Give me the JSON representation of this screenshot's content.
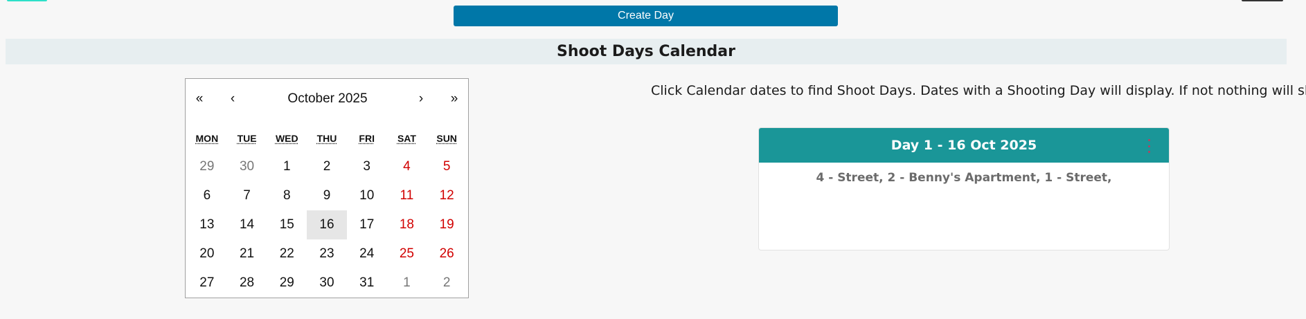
{
  "actions": {
    "create_day_label": "Create Day"
  },
  "section": {
    "title": "Shoot Days Calendar"
  },
  "calendar": {
    "nav": {
      "first": "«",
      "prev": "‹",
      "label": "October 2025",
      "next": "›",
      "last": "»"
    },
    "weekdays": [
      "MON",
      "TUE",
      "WED",
      "THU",
      "FRI",
      "SAT",
      "SUN"
    ],
    "days": [
      {
        "d": "29",
        "neighbor": true,
        "weekend": false
      },
      {
        "d": "30",
        "neighbor": true,
        "weekend": false
      },
      {
        "d": "1",
        "neighbor": false,
        "weekend": false
      },
      {
        "d": "2",
        "neighbor": false,
        "weekend": false
      },
      {
        "d": "3",
        "neighbor": false,
        "weekend": false
      },
      {
        "d": "4",
        "neighbor": false,
        "weekend": true
      },
      {
        "d": "5",
        "neighbor": false,
        "weekend": true
      },
      {
        "d": "6",
        "neighbor": false,
        "weekend": false
      },
      {
        "d": "7",
        "neighbor": false,
        "weekend": false
      },
      {
        "d": "8",
        "neighbor": false,
        "weekend": false
      },
      {
        "d": "9",
        "neighbor": false,
        "weekend": false
      },
      {
        "d": "10",
        "neighbor": false,
        "weekend": false
      },
      {
        "d": "11",
        "neighbor": false,
        "weekend": true
      },
      {
        "d": "12",
        "neighbor": false,
        "weekend": true
      },
      {
        "d": "13",
        "neighbor": false,
        "weekend": false
      },
      {
        "d": "14",
        "neighbor": false,
        "weekend": false
      },
      {
        "d": "15",
        "neighbor": false,
        "weekend": false
      },
      {
        "d": "16",
        "neighbor": false,
        "weekend": false,
        "selected": true
      },
      {
        "d": "17",
        "neighbor": false,
        "weekend": false
      },
      {
        "d": "18",
        "neighbor": false,
        "weekend": true
      },
      {
        "d": "19",
        "neighbor": false,
        "weekend": true
      },
      {
        "d": "20",
        "neighbor": false,
        "weekend": false
      },
      {
        "d": "21",
        "neighbor": false,
        "weekend": false
      },
      {
        "d": "22",
        "neighbor": false,
        "weekend": false
      },
      {
        "d": "23",
        "neighbor": false,
        "weekend": false
      },
      {
        "d": "24",
        "neighbor": false,
        "weekend": false
      },
      {
        "d": "25",
        "neighbor": false,
        "weekend": true
      },
      {
        "d": "26",
        "neighbor": false,
        "weekend": true
      },
      {
        "d": "27",
        "neighbor": false,
        "weekend": false
      },
      {
        "d": "28",
        "neighbor": false,
        "weekend": false
      },
      {
        "d": "29",
        "neighbor": false,
        "weekend": false
      },
      {
        "d": "30",
        "neighbor": false,
        "weekend": false
      },
      {
        "d": "31",
        "neighbor": false,
        "weekend": false
      },
      {
        "d": "1",
        "neighbor": true,
        "weekend": false
      },
      {
        "d": "2",
        "neighbor": true,
        "weekend": false
      }
    ]
  },
  "instructions": "Click Calendar dates to find Shoot Days. Dates with a Shooting Day will display. If not nothing will show.",
  "shoot_day_card": {
    "title": "Day 1 - 16 Oct 2025",
    "menu_icon": "vertical-ellipsis-icon",
    "scenes": "4 - Street, 2 - Benny's Apartment, 1 - Street,"
  },
  "colors": {
    "primary_button": "#0077a8",
    "card_header": "#1a9698",
    "weekend_text": "#d10000"
  }
}
